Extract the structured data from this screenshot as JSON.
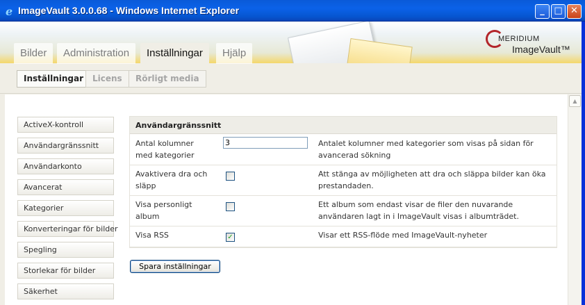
{
  "window": {
    "title": "ImageVault 3.0.0.68 - Windows Internet Explorer",
    "minimize_glyph": "_",
    "maximize_glyph": "□",
    "close_glyph": "✕"
  },
  "logo": {
    "line1": "MERIDIUM",
    "line2": "ImageVault™"
  },
  "main_tabs": [
    {
      "label": "Bilder"
    },
    {
      "label": "Administration"
    },
    {
      "label": "Inställningar"
    },
    {
      "label": "Hjälp"
    }
  ],
  "sub_tabs": [
    {
      "label": "Inställningar"
    },
    {
      "label": "Licens"
    },
    {
      "label": "Rörligt media"
    }
  ],
  "sidebar": {
    "items": [
      {
        "label": "ActiveX-kontroll"
      },
      {
        "label": "Användargränssnitt"
      },
      {
        "label": "Användarkonto"
      },
      {
        "label": "Avancerat"
      },
      {
        "label": "Kategorier"
      },
      {
        "label": "Konverteringar för bilder"
      },
      {
        "label": "Spegling"
      },
      {
        "label": "Storlekar för bilder"
      },
      {
        "label": "Säkerhet"
      }
    ]
  },
  "panel": {
    "title": "Användargränssnitt",
    "rows": [
      {
        "label": "Antal kolumner med kategorier",
        "value": "3",
        "description": "Antalet kolumner med kategorier som visas på sidan för avancerad sökning"
      },
      {
        "label": "Avaktivera dra och släpp",
        "checked": false,
        "description": "Att stänga av möjligheten att dra och släppa bilder kan öka prestandaden."
      },
      {
        "label": "Visa personligt album",
        "checked": false,
        "description": "Ett album som endast visar de filer den nuvarande användaren lagt in i ImageVault visas i albumträdet."
      },
      {
        "label": "Visa RSS",
        "checked": true,
        "check_glyph": "✓",
        "description": "Visar ett RSS-flöde med ImageVault-nyheter"
      }
    ]
  },
  "save_button": {
    "label": "Spara inställningar"
  },
  "colors": {
    "titlebar": "#0b62e8",
    "accent_red": "#b3252a",
    "check_green": "#21a121"
  }
}
